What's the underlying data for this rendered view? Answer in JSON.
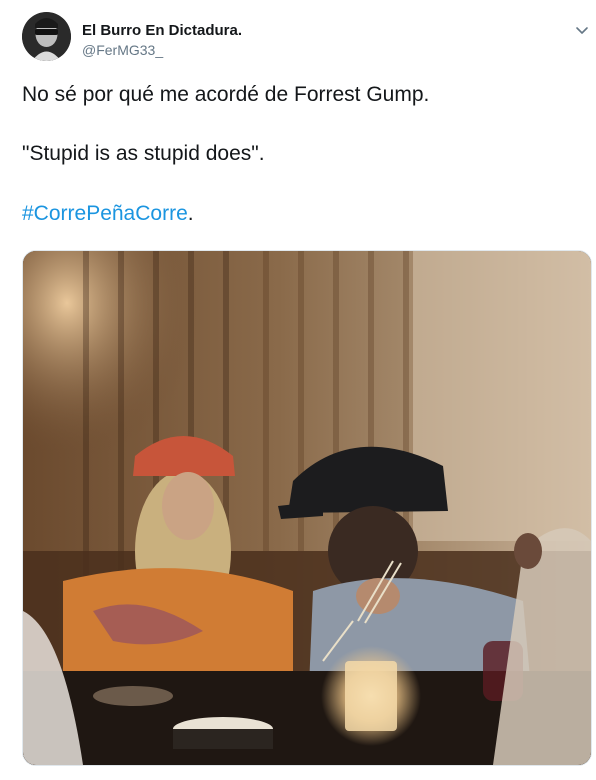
{
  "tweet": {
    "display_name": "El Burro En Dictadura.",
    "handle": "@FerMG33_",
    "text_line_1": "No sé por qué me acordé de Forrest Gump.",
    "text_line_2": "\"Stupid is as stupid does\".",
    "hashtag": "#CorrePeñaCorre",
    "hashtag_suffix": "."
  },
  "icons": {
    "avatar": "user-avatar",
    "caret": "chevron-down-icon"
  },
  "colors": {
    "link": "#1b95e0",
    "secondary_text": "#657786",
    "primary_text": "#14171a"
  }
}
